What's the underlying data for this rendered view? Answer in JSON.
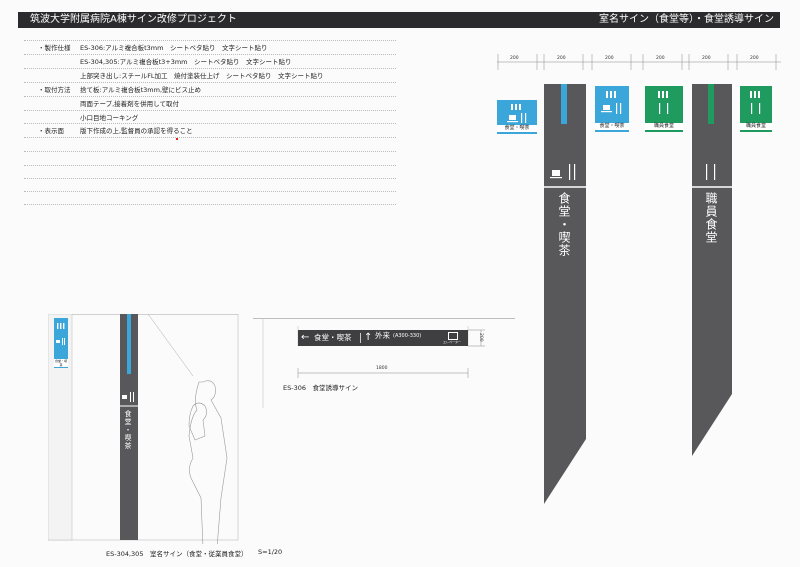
{
  "header": {
    "title_left": "筑波大学附属病院A棟サイン改修プロジェクト",
    "title_right": "室名サイン（食堂等）・食堂誘導サイン"
  },
  "specs": {
    "manufacture_label": "・製作仕様",
    "manufacture_lines": [
      "ES-306:アルミ複合板t3mm　シートベタ貼り　文字シート貼り",
      "ES-304,305:アルミ複合板t3+3mm　シートベタ貼り　文字シート貼り",
      "上部突き出し:スチールFL加工　焼付塗装仕上げ　シートベタ貼り　文字シート貼り"
    ],
    "mounting_label": "・取付方法",
    "mounting_lines": [
      "捨て板:アルミ複合板t3mm,壁にビス止め",
      "両面テープ,接着剤を併用して取付",
      "小口目地コーキング"
    ],
    "display_label": "・表示面",
    "display_lines": [
      "版下作成の上,監督員の承認を得ること"
    ]
  },
  "elevations": {
    "dimension": "200",
    "panels": [
      {
        "label": "食堂・喫茶",
        "color": "#3ba6d9"
      },
      {
        "label": "食堂・喫茶",
        "color": "#3ba6d9"
      },
      {
        "label": "職員食堂",
        "color": "#1f9b5f"
      },
      {
        "label": "職員食堂",
        "color": "#1f9b5f"
      }
    ],
    "pole1_text": "食堂・喫茶",
    "pole2_text": "職員食堂"
  },
  "guide_sign": {
    "left_text": "食堂・喫茶",
    "right_text": "外来",
    "right_sub": "(A300-330)",
    "small_text": "エレベーター",
    "height_dim": "200",
    "width_dim": "1800",
    "caption": "ES-306　食堂誘導サイン"
  },
  "side_view": {
    "panel_label": "食堂・喫茶",
    "pole_text": "食堂・喫茶",
    "caption": "ES-304,305　室名サイン（食堂・従業員食堂）",
    "scale": "S=1/20"
  },
  "colors": {
    "blue": "#3ba6d9",
    "green": "#1f9b5f",
    "pole": "#58585a",
    "bar": "#2b2b2d"
  }
}
